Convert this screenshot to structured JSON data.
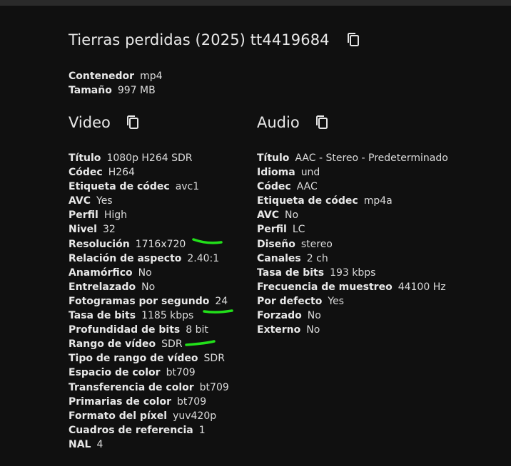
{
  "header": {
    "title": "Tierras perdidas (2025) tt4419684"
  },
  "general": [
    {
      "k": "Contenedor",
      "v": "mp4"
    },
    {
      "k": "Tamaño",
      "v": "997 MB"
    }
  ],
  "video": {
    "heading": "Video",
    "rows": [
      {
        "k": "Título",
        "v": "1080p H264 SDR"
      },
      {
        "k": "Códec",
        "v": "H264"
      },
      {
        "k": "Etiqueta de códec",
        "v": "avc1"
      },
      {
        "k": "AVC",
        "v": "Yes"
      },
      {
        "k": "Perfil",
        "v": "High"
      },
      {
        "k": "Nivel",
        "v": "32"
      },
      {
        "k": "Resolución",
        "v": "1716x720"
      },
      {
        "k": "Relación de aspecto",
        "v": "2.40:1"
      },
      {
        "k": "Anamórfico",
        "v": "No"
      },
      {
        "k": "Entrelazado",
        "v": "No"
      },
      {
        "k": "Fotogramas por segundo",
        "v": "24"
      },
      {
        "k": "Tasa de bits",
        "v": "1185 kbps"
      },
      {
        "k": "Profundidad de bits",
        "v": "8 bit"
      },
      {
        "k": "Rango de vídeo",
        "v": "SDR"
      },
      {
        "k": "Tipo de rango de vídeo",
        "v": "SDR"
      },
      {
        "k": "Espacio de color",
        "v": "bt709"
      },
      {
        "k": "Transferencia de color",
        "v": "bt709"
      },
      {
        "k": "Primarias de color",
        "v": "bt709"
      },
      {
        "k": "Formato del píxel",
        "v": "yuv420p"
      },
      {
        "k": "Cuadros de referencia",
        "v": "1"
      },
      {
        "k": "NAL",
        "v": "4"
      }
    ]
  },
  "audio": {
    "heading": "Audio",
    "rows": [
      {
        "k": "Título",
        "v": "AAC - Stereo - Predeterminado"
      },
      {
        "k": "Idioma",
        "v": "und"
      },
      {
        "k": "Códec",
        "v": "AAC"
      },
      {
        "k": "Etiqueta de códec",
        "v": "mp4a"
      },
      {
        "k": "AVC",
        "v": "No"
      },
      {
        "k": "Perfil",
        "v": "LC"
      },
      {
        "k": "Diseño",
        "v": "stereo"
      },
      {
        "k": "Canales",
        "v": "2 ch"
      },
      {
        "k": "Tasa de bits",
        "v": "193 kbps"
      },
      {
        "k": "Frecuencia de muestreo",
        "v": "44100 Hz"
      },
      {
        "k": "Por defecto",
        "v": "Yes"
      },
      {
        "k": "Forzado",
        "v": "No"
      },
      {
        "k": "Externo",
        "v": "No"
      }
    ]
  },
  "icons": {
    "copy": "copy-icon"
  },
  "colors": {
    "background": "#101010",
    "topbar": "#2a2a2a",
    "text": "#e6e6e6",
    "annotation": "#22e01a"
  }
}
